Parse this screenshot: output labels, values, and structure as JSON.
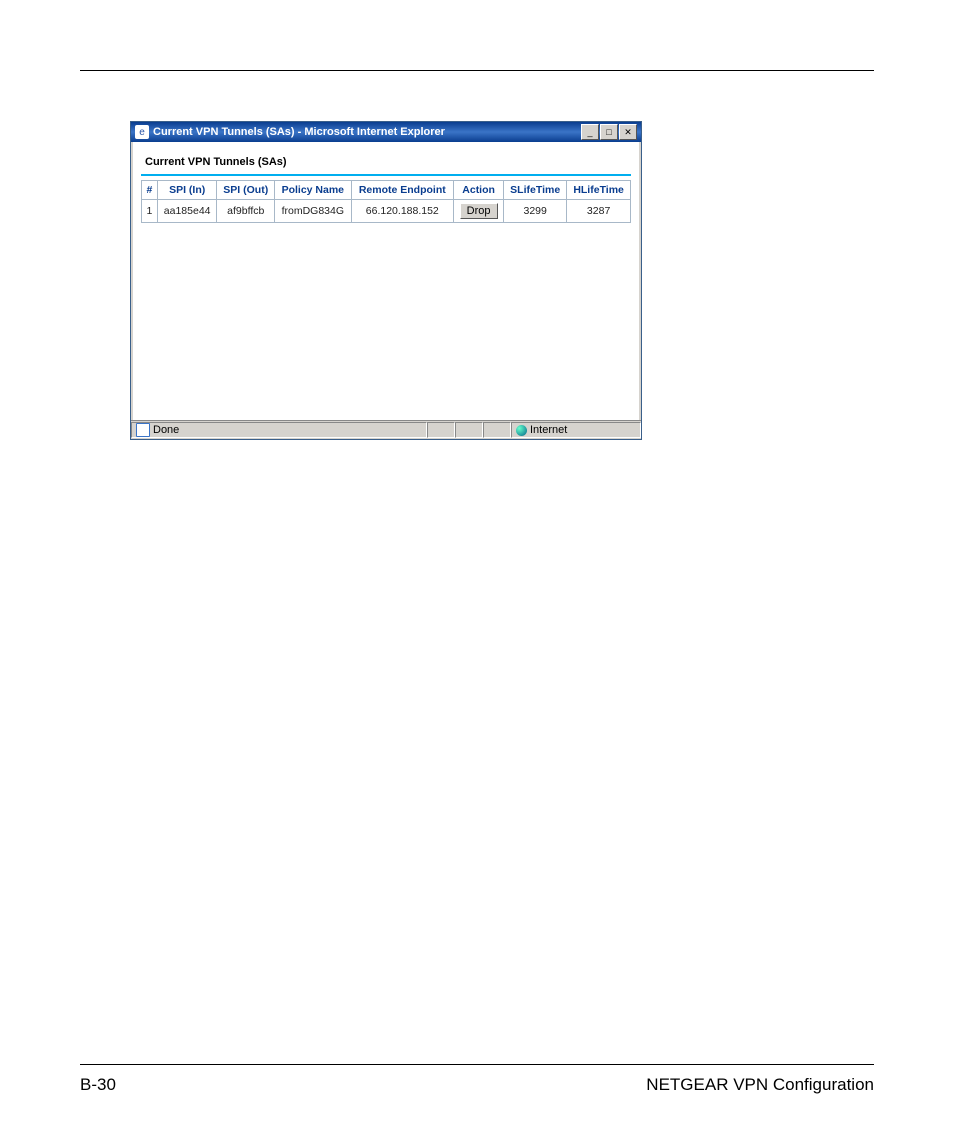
{
  "window": {
    "title": "Current VPN Tunnels (SAs) - Microsoft Internet Explorer"
  },
  "panel": {
    "heading": "Current VPN Tunnels (SAs)"
  },
  "table": {
    "headers": {
      "num": "#",
      "spi_in": "SPI (In)",
      "spi_out": "SPI (Out)",
      "policy": "Policy Name",
      "endpoint": "Remote Endpoint",
      "action": "Action",
      "slife": "SLifeTime",
      "hlife": "HLifeTime"
    },
    "row": {
      "num": "1",
      "spi_in": "aa185e44",
      "spi_out": "af9bffcb",
      "policy": "fromDG834G",
      "endpoint": "66.120.188.152",
      "action_label": "Drop",
      "slife": "3299",
      "hlife": "3287"
    }
  },
  "status": {
    "left": "Done",
    "zone": "Internet"
  },
  "footer": {
    "page_number": "B-30",
    "doc_title": "NETGEAR VPN Configuration"
  }
}
